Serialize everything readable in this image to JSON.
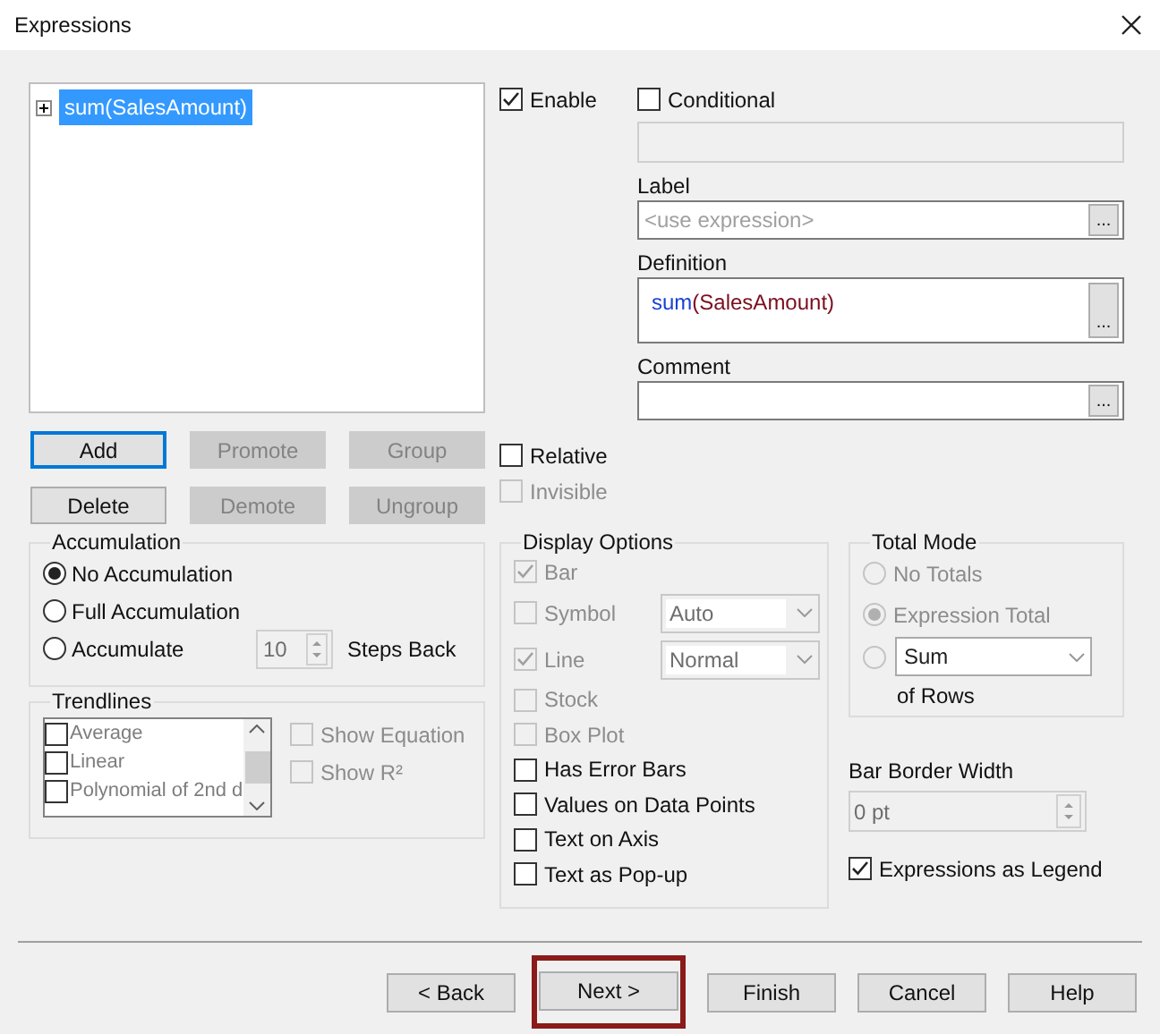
{
  "window": {
    "title": "Expressions"
  },
  "expression_tree": {
    "items": [
      {
        "label": "sum(SalesAmount)",
        "expanded": false,
        "selected": true
      }
    ]
  },
  "expression_buttons": [
    {
      "label": "Add",
      "disabled": false,
      "focused": true
    },
    {
      "label": "Promote",
      "disabled": true,
      "focused": false
    },
    {
      "label": "Group",
      "disabled": true,
      "focused": false
    },
    {
      "label": "Delete",
      "disabled": false,
      "focused": false
    },
    {
      "label": "Demote",
      "disabled": true,
      "focused": false
    },
    {
      "label": "Ungroup",
      "disabled": true,
      "focused": false
    }
  ],
  "enable": {
    "label": "Enable",
    "checked": true
  },
  "conditional": {
    "label": "Conditional",
    "checked": false
  },
  "label_field": {
    "label": "Label",
    "placeholder": "<use expression>",
    "button": "..."
  },
  "definition_field": {
    "label": "Definition",
    "tokens": [
      {
        "kind": "function",
        "text": "sum"
      },
      {
        "kind": "text",
        "text": "(SalesAmount)"
      }
    ],
    "button": "..."
  },
  "comment_field": {
    "label": "Comment",
    "button": "..."
  },
  "relative": {
    "label": "Relative",
    "checked": false,
    "disabled": false
  },
  "invisible": {
    "label": "Invisible",
    "checked": false,
    "disabled": true
  },
  "accumulation": {
    "title": "Accumulation",
    "options": [
      {
        "label": "No Accumulation",
        "selected": true
      },
      {
        "label": "Full Accumulation",
        "selected": false
      },
      {
        "label": "Accumulate",
        "selected": false
      }
    ],
    "steps": {
      "value": "10",
      "label": "Steps Back"
    }
  },
  "trendlines": {
    "title": "Trendlines",
    "items": [
      {
        "label": "Average",
        "checked": false
      },
      {
        "label": "Linear",
        "checked": false
      },
      {
        "label": "Polynomial of 2nd d",
        "checked": false
      }
    ],
    "options": [
      {
        "label": "Show Equation",
        "checked": false,
        "disabled": true
      },
      {
        "label": "Show R²",
        "checked": false,
        "disabled": true
      }
    ]
  },
  "display_options": {
    "title": "Display Options",
    "items": [
      {
        "kind": "checkbox",
        "label": "Bar",
        "checked": true,
        "disabled": true
      },
      {
        "kind": "dropdown",
        "label": "Symbol",
        "checked": false,
        "disabled": true,
        "value": "Auto"
      },
      {
        "kind": "dropdown",
        "label": "Line",
        "checked": true,
        "disabled": true,
        "value": "Normal"
      },
      {
        "kind": "checkbox",
        "label": "Stock",
        "checked": false,
        "disabled": true
      },
      {
        "kind": "checkbox",
        "label": "Box Plot",
        "checked": false,
        "disabled": true
      },
      {
        "kind": "checkbox",
        "label": "Has Error Bars",
        "checked": false,
        "disabled": false
      },
      {
        "kind": "checkbox",
        "label": "Values on Data Points",
        "checked": false,
        "disabled": false
      },
      {
        "kind": "checkbox",
        "label": "Text on Axis",
        "checked": false,
        "disabled": false
      },
      {
        "kind": "checkbox",
        "label": "Text as Pop-up",
        "checked": false,
        "disabled": false
      }
    ]
  },
  "total_mode": {
    "title": "Total Mode",
    "options": [
      {
        "kind": "radio",
        "label": "No Totals",
        "selected": false,
        "disabled": true
      },
      {
        "kind": "radio",
        "label": "Expression Total",
        "selected": true,
        "disabled": true
      },
      {
        "kind": "dropdown",
        "value": "Sum",
        "suffix": "of Rows",
        "selected": false,
        "disabled": true
      }
    ]
  },
  "bar_border_width": {
    "label": "Bar Border Width",
    "value": "0 pt"
  },
  "expressions_as_legend": {
    "label": "Expressions as Legend",
    "checked": true
  },
  "footer_buttons": [
    {
      "label": "< Back",
      "highlighted": false
    },
    {
      "label": "Next >",
      "highlighted": true
    },
    {
      "label": "Finish",
      "highlighted": false
    },
    {
      "label": "Cancel",
      "highlighted": false
    },
    {
      "label": "Help",
      "highlighted": false
    }
  ]
}
